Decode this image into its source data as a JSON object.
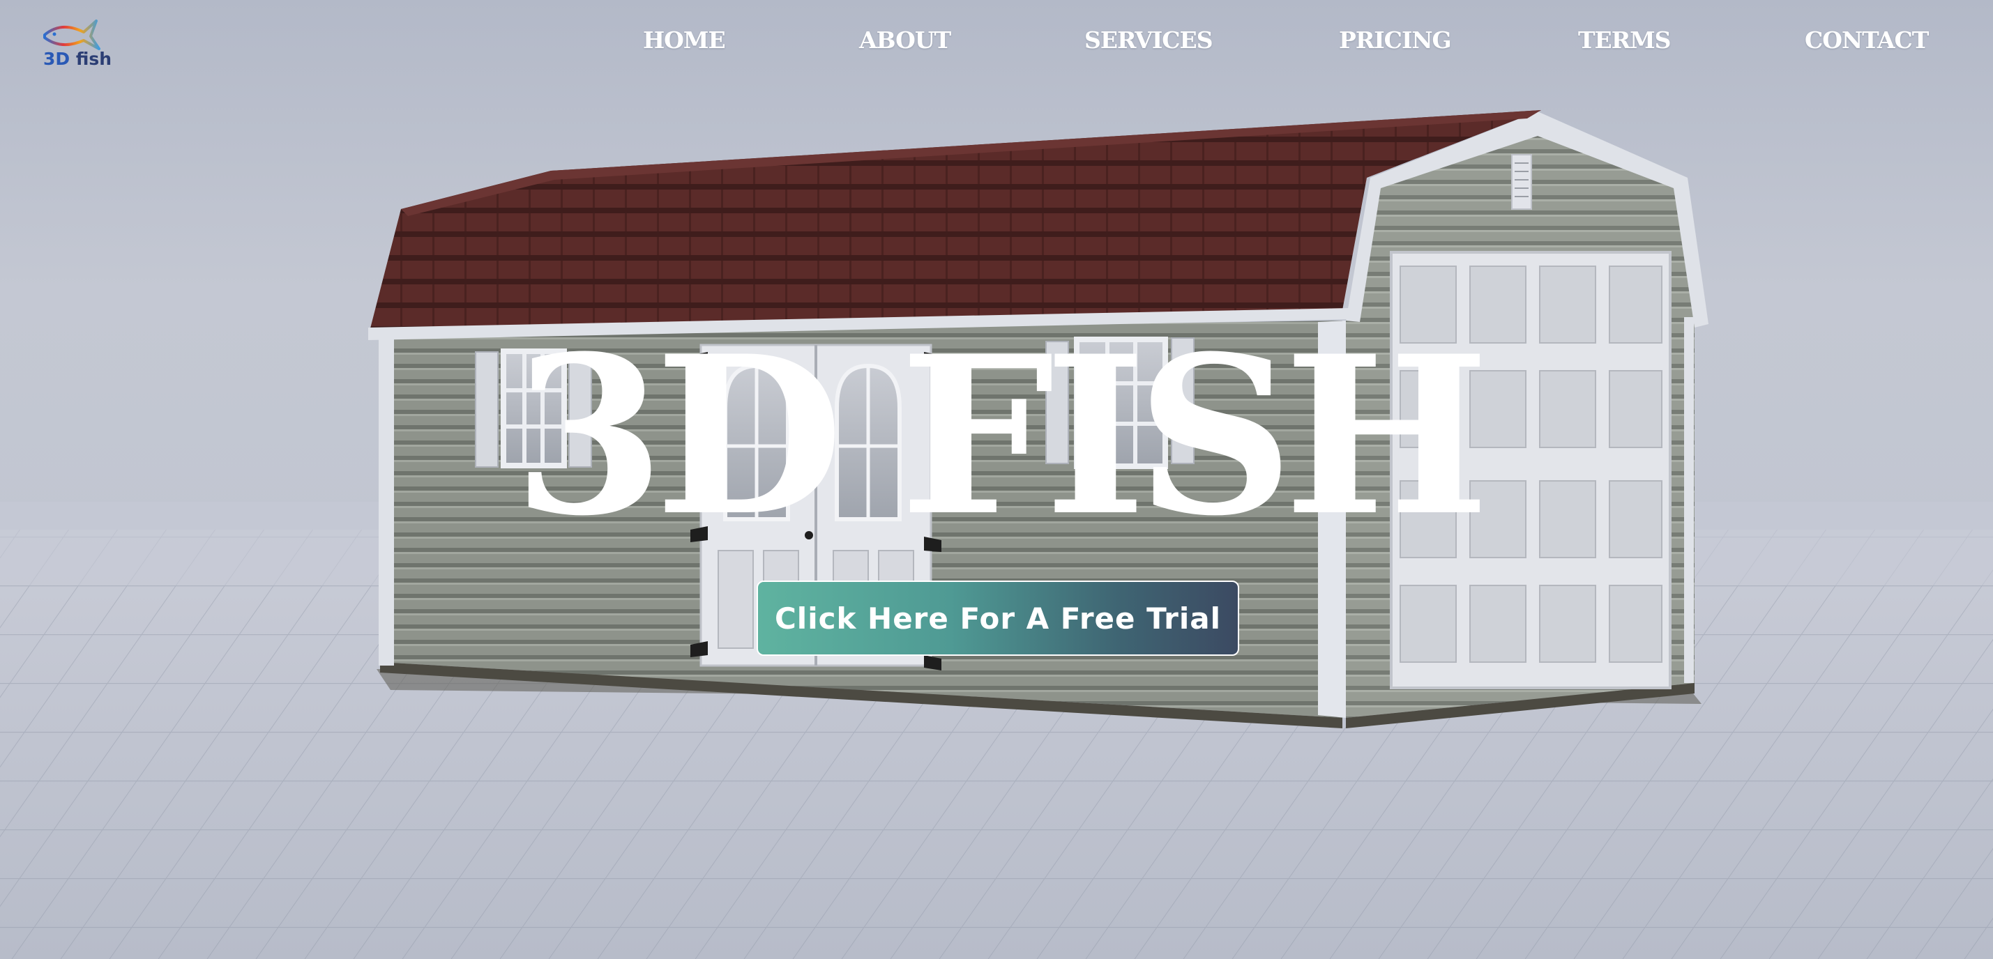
{
  "brand": {
    "logo_text_prefix": "3D",
    "logo_text_suffix": " fish",
    "logo_icon": "fish-logo-icon"
  },
  "nav": {
    "items": [
      {
        "label": "HOME"
      },
      {
        "label": "ABOUT"
      },
      {
        "label": "SERVICES"
      },
      {
        "label": "PRICING"
      },
      {
        "label": "TERMS"
      },
      {
        "label": "CONTACT"
      }
    ]
  },
  "hero": {
    "title": "3D FISH",
    "cta_label": "Click Here For A Free Trial",
    "background": "3d-shed-render-image"
  },
  "colors": {
    "roof": "#5a2a28",
    "siding": "#8c918a",
    "trim": "#dfe2e8",
    "cta_start": "#5fb3a0",
    "cta_end": "#3c4a62"
  }
}
